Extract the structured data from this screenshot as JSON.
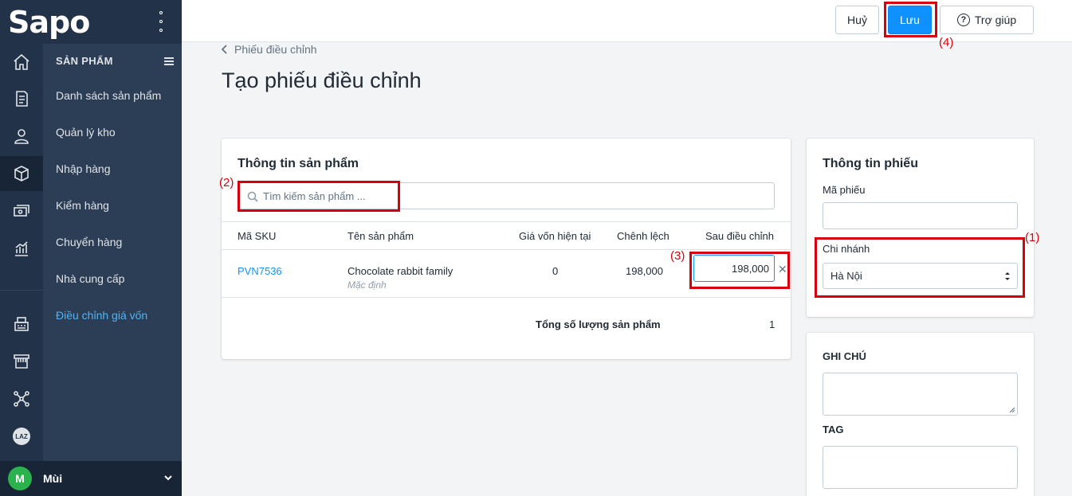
{
  "app": {
    "logo_text": "Sapo",
    "brand_color": "#0f92ff",
    "sidebar_color": "#223349"
  },
  "rail_icons": [
    "home-icon",
    "orders-icon",
    "customers-icon",
    "products-icon",
    "cashbook-icon",
    "reports-icon",
    "pos-icon",
    "store-icon",
    "connect-icon",
    "lazada-icon"
  ],
  "lazada_badge": "LAZ",
  "submenu": {
    "title": "SẢN PHẨM",
    "items": [
      {
        "label": "Danh sách sản phẩm"
      },
      {
        "label": "Quản lý kho"
      },
      {
        "label": "Nhập hàng"
      },
      {
        "label": "Kiểm hàng"
      },
      {
        "label": "Chuyển hàng"
      },
      {
        "label": "Nhà cung cấp"
      },
      {
        "label": "Điều chỉnh giá vốn",
        "active": true
      }
    ]
  },
  "user": {
    "initial": "M",
    "name": "Mùi"
  },
  "toolbar": {
    "cancel_label": "Huỷ",
    "save_label": "Lưu",
    "help_label": "Trợ giúp"
  },
  "page": {
    "breadcrumb": "Phiếu điều chỉnh",
    "title": "Tạo phiếu điều chỉnh"
  },
  "product_card": {
    "title": "Thông tin sản phẩm",
    "search_placeholder": "Tìm kiếm sản phẩm ...",
    "columns": [
      "Mã SKU",
      "Tên sản phẩm",
      "Giá vốn hiện tại",
      "Chênh lệch",
      "Sau điều chỉnh"
    ],
    "rows": [
      {
        "sku": "PVN7536",
        "name": "Chocolate rabbit family",
        "variant": "Mặc định",
        "current_cost": "0",
        "difference": "198,000",
        "adjusted": "198,000"
      }
    ],
    "total_label": "Tổng số lượng sản phẩm",
    "total_value": "1"
  },
  "info_card": {
    "title": "Thông tin phiếu",
    "code_label": "Mã phiếu",
    "code_value": "",
    "branch_label": "Chi nhánh",
    "branch_value": "Hà Nội"
  },
  "notes_card": {
    "note_label": "GHI CHÚ",
    "tag_label": "TAG"
  },
  "annotations": {
    "a1": "(1)",
    "a2": "(2)",
    "a3": "(3)",
    "a4": "(4)",
    "color": "#d9000d"
  }
}
